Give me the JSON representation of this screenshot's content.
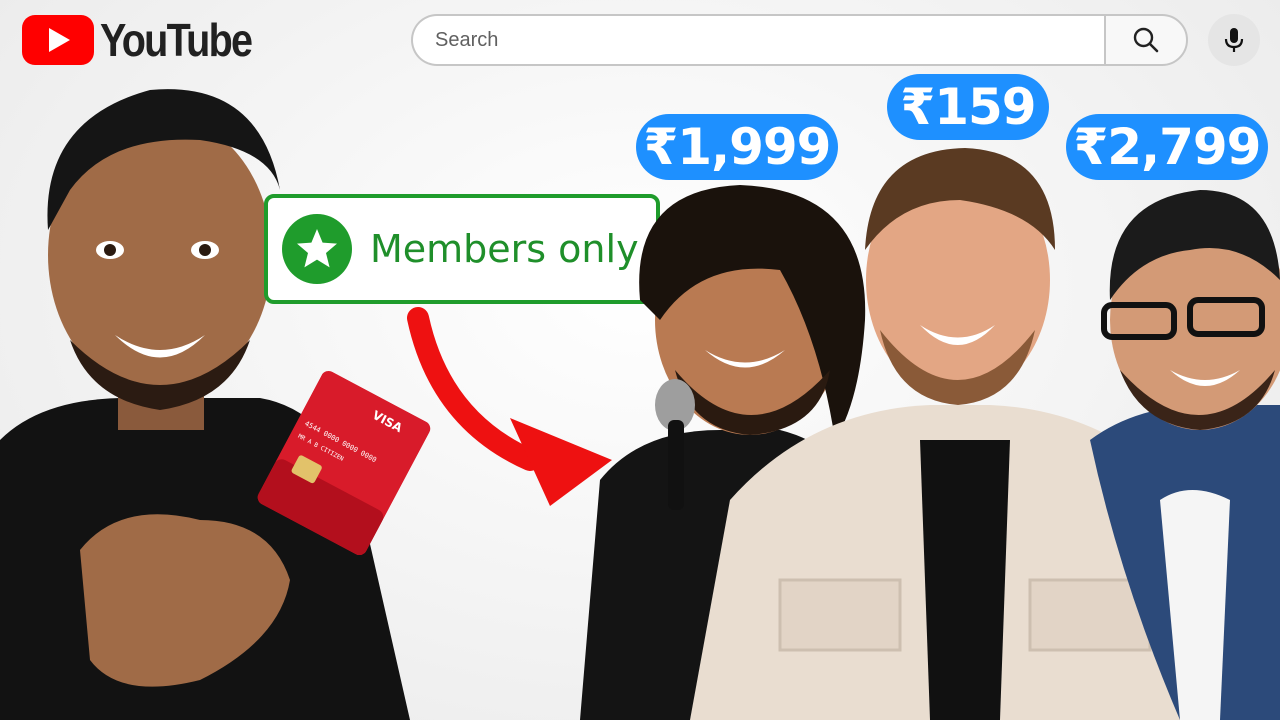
{
  "header": {
    "logo_text": "YouTube",
    "search": {
      "placeholder": "Search"
    },
    "icons": [
      "youtube-logo-icon",
      "search-icon",
      "mic-icon"
    ]
  },
  "thumbnail": {
    "members_label": "Members only",
    "card_text": {
      "brand": "VISA",
      "number": "4544 0000 0000 0000",
      "holder": "MR A B CITIZEN"
    },
    "prices": [
      {
        "label": "₹1,999",
        "color": "#1e90ff"
      },
      {
        "label": "₹159",
        "color": "#1e90ff"
      },
      {
        "label": "₹2,799",
        "color": "#1e90ff"
      }
    ],
    "colors": {
      "accent_green": "#1f9c2c",
      "arrow_red": "#ee1111",
      "badge_blue": "#1e90ff",
      "yt_red": "#ff0000"
    }
  }
}
